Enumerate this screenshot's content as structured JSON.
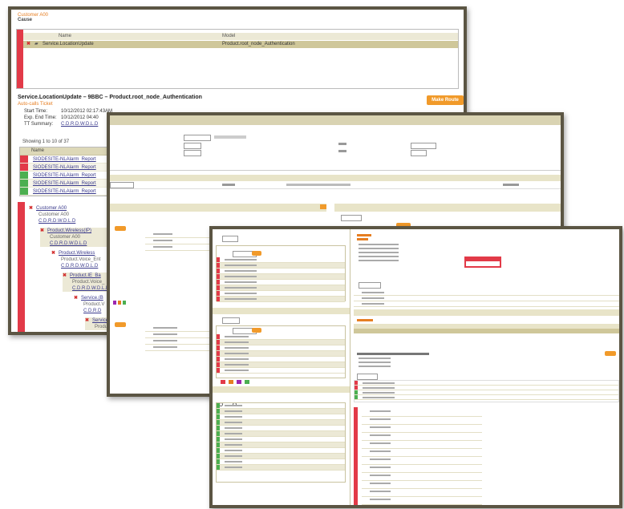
{
  "w1": {
    "header_title": "Customer A00",
    "section_label": "Cause",
    "col_name": "Name",
    "col_model": "Model",
    "row_name": "Service.LocationUpdate",
    "row_model": "Product.root_node_Authentication",
    "detail_title": "Service.LocationUpdate – 9BBC – Product.root_node_Authentication",
    "detail_sub": "Auto-calls Ticket",
    "make_button": "Make Route",
    "start_label": "Start Time:",
    "start_value": "10/12/2012 02:17:43AM",
    "exp_label": "Exp. End Time:",
    "exp_value": "10/12/2012 04:40",
    "tt_label": "TT Summary:",
    "tt_value": "C.D.R.D.W.D.L.D",
    "showing": "Showing 1 to 10 of 37",
    "list_header": "Name",
    "list_items": [
      {
        "text": "SIODESITE-NLAlarm_Report",
        "color": "#e23a48"
      },
      {
        "text": "SIODESITE-NLAlarm_Report",
        "color": "#e23a48"
      },
      {
        "text": "SIODESITE-NLAlarm_Report",
        "color": "#4caf50"
      },
      {
        "text": "SIODESITE-NLAlarm_Report",
        "color": "#4caf50"
      },
      {
        "text": "SIODESITE-NLAlarm_Report",
        "color": "#4caf50"
      }
    ],
    "tree": [
      {
        "link": "Customer A00",
        "sub1": "Customer A00",
        "sub2": "C.D.R.D.W.D.L.D",
        "indent": 0
      },
      {
        "link": "Product.Wireless(IP)",
        "sub1": "Customer A00",
        "sub2": "C.D.R.D.W.D.L.D",
        "indent": 1
      },
      {
        "link": "Product.Wireless",
        "sub1": "Product.Voice_Ent",
        "sub2": "C.D.R.D.W.D.L.D",
        "indent": 2
      },
      {
        "link": "Product.IE_Ba",
        "sub1": "Product.Voice_",
        "sub2": "C.D.R.D.W.D.L.D",
        "indent": 3
      },
      {
        "link": "Service.(B",
        "sub1": "Product.V",
        "sub2": "C.D.R.D",
        "indent": 4
      },
      {
        "link": "Service",
        "sub1": "Product",
        "sub2": "",
        "indent": 5
      }
    ]
  },
  "w3": {
    "search_box": "Search",
    "detail_title": "Service.LocationUpdate – 9BBC – Product.root_node_Authentication",
    "showing": "Showing 1 to 10 of 37"
  }
}
